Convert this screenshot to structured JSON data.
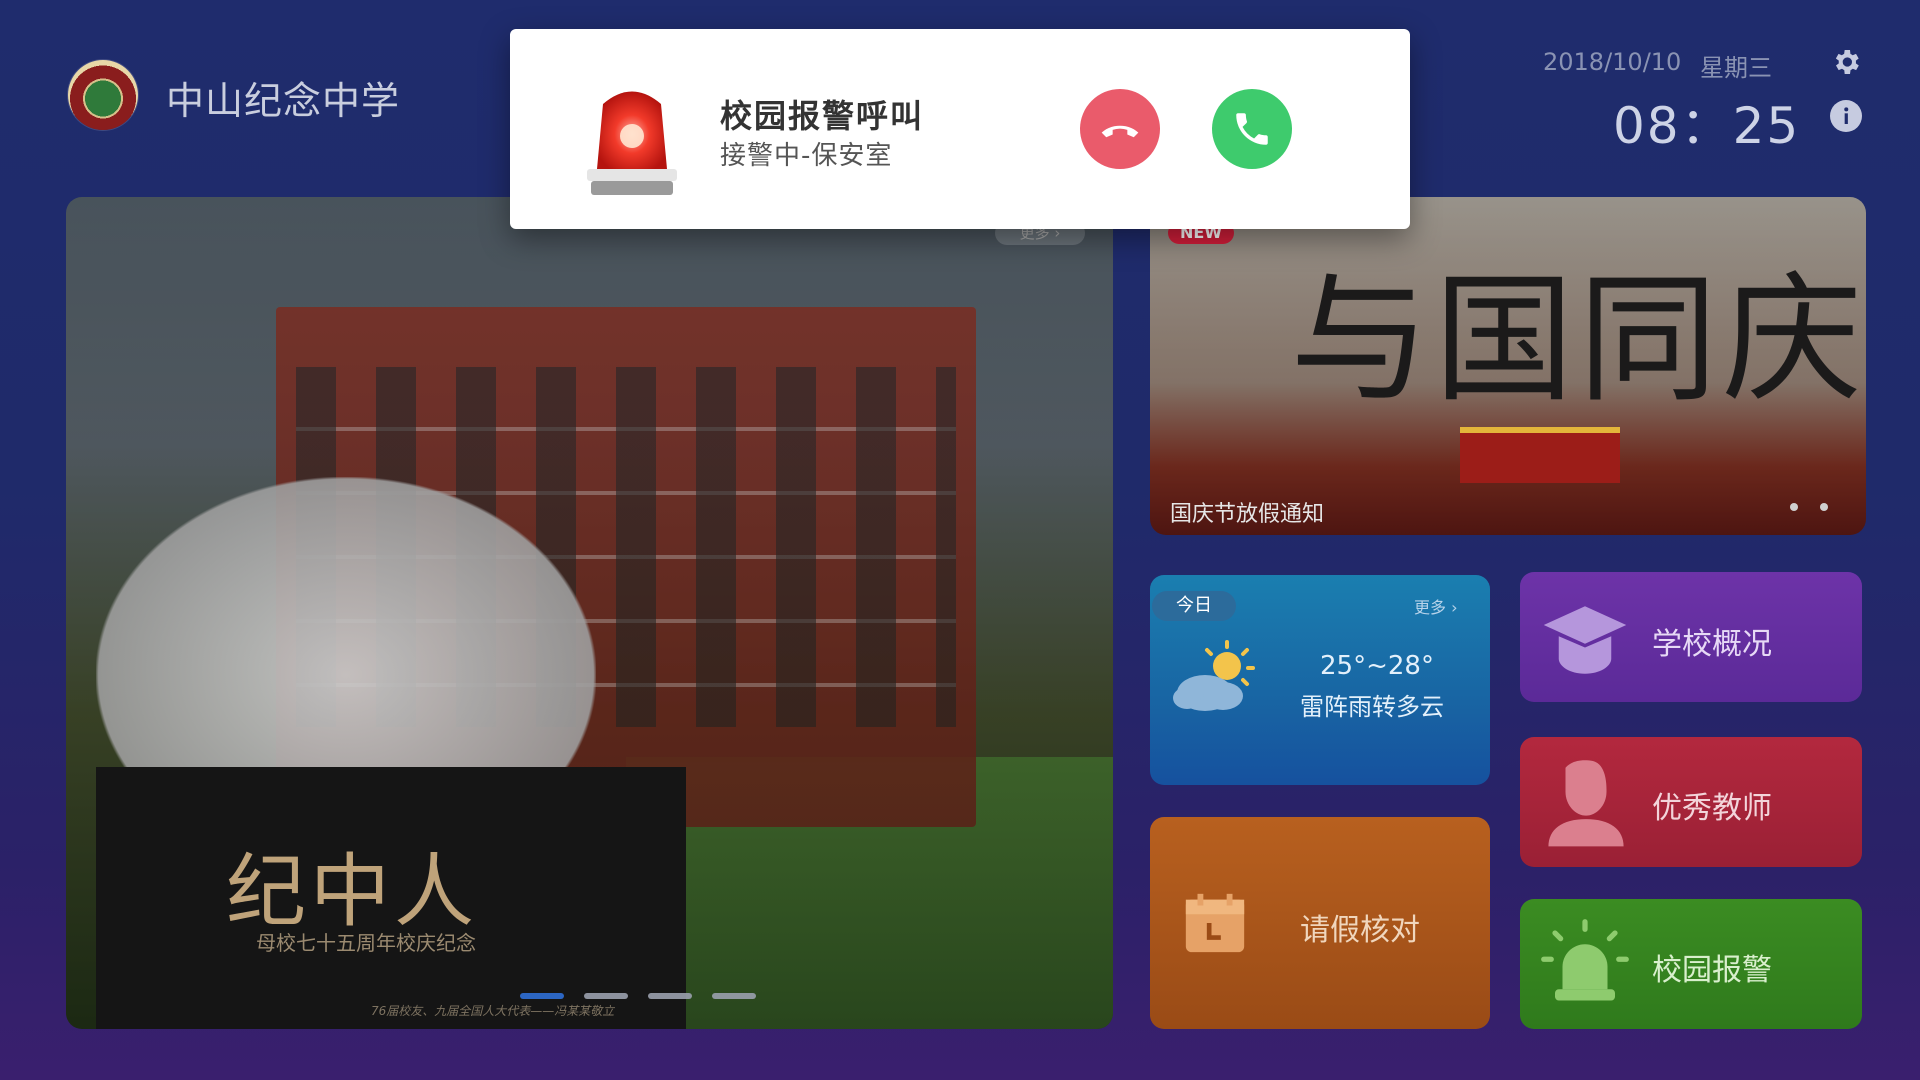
{
  "header": {
    "school_name": "中山纪念中学",
    "date": "2018/10/10",
    "weekday": "星期三",
    "time": "08：25",
    "settings_icon": "gear-icon",
    "info_icon": "info-icon"
  },
  "hero": {
    "more_label": "更多 ›",
    "pedestal_title": "纪中人",
    "pedestal_subtitle": "母校七十五周年校庆纪念",
    "pedestal_footer": "76届校友、九届全国人大代表——冯某某敬立",
    "slides_count": 4,
    "active_slide": 1
  },
  "banner": {
    "badge": "NEW",
    "calligraphy": "与国同庆",
    "caption": "国庆节放假通知"
  },
  "weather": {
    "badge": "今日",
    "more_label": "更多",
    "temperature": "25°~28°",
    "description": "雷阵雨转多云",
    "icon": "partly-cloudy-sun-icon"
  },
  "tiles": {
    "leave": "请假核对",
    "school": "学校概况",
    "teacher": "优秀教师",
    "alarm": "校园报警"
  },
  "popup": {
    "title": "校园报警呼叫",
    "subtitle": "接警中-保安室",
    "decline_icon": "hang-up-icon",
    "accept_icon": "phone-icon"
  },
  "colors": {
    "accept": "#3ecb6d",
    "decline": "#ea5b6b",
    "weather": "#1a86b6",
    "leave": "#b8601f",
    "school": "#6d33a8",
    "teacher": "#b3283e",
    "alarm": "#3b8c22"
  }
}
